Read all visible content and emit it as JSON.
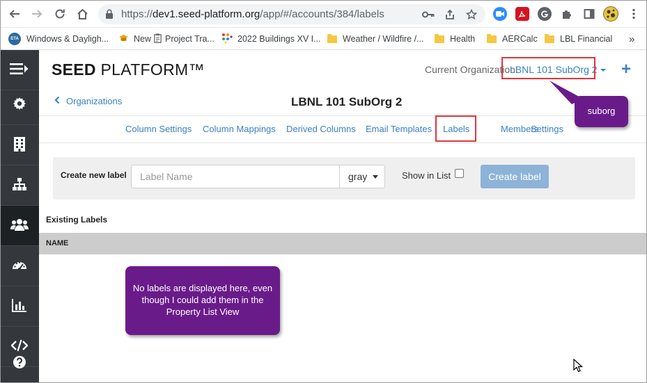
{
  "browser": {
    "url_prefix": "https://",
    "url_host": "dev1.seed-platform.org",
    "url_path": "/app/#/accounts/384/labels",
    "bookmarks": [
      {
        "label": "Windows & Dayligh...",
        "icon": "eta-icon"
      },
      {
        "label": "New",
        "icon": "hat-icon"
      },
      {
        "label": "Project Tra...",
        "icon": "clipboard-icon"
      },
      {
        "label": "2022 Buildings XV I...",
        "icon": "dots-icon"
      },
      {
        "label": "Weather / Wildfire /...",
        "icon": "folder-icon"
      },
      {
        "label": "Health",
        "icon": "folder-icon"
      },
      {
        "label": "AERCalc",
        "icon": "folder-icon"
      },
      {
        "label": "LBL Financial",
        "icon": "folder-icon"
      }
    ],
    "bookmark_eta_text": "ETA",
    "more_bookmarks": "»"
  },
  "app": {
    "logo_bold": "SEED",
    "logo_rest": " PLATFORM™",
    "org_label": "Current Organization:",
    "org_name": "LBNL 101 SubOrg 2",
    "plus": "+"
  },
  "page": {
    "back_link": "Organizations",
    "title": "LBNL 101 SubOrg 2"
  },
  "tabs": [
    "Column Settings",
    "Column Mappings",
    "Derived Columns",
    "Email Templates",
    "Labels",
    "Members",
    "Settings"
  ],
  "create": {
    "label": "Create new label",
    "placeholder": "Label Name",
    "color_value": "gray",
    "show_in_list": "Show in List",
    "button": "Create label"
  },
  "existing": {
    "heading": "Existing Labels",
    "column_name": "NAME"
  },
  "annotations": {
    "suborg": "suborg",
    "note": "No labels are displayed here, even though I could add them in the Property List View"
  },
  "colors": {
    "accent": "#3a82c4",
    "callout": "#6a1b8a",
    "highlight": "#e2343a",
    "sidebar": "#34383c"
  }
}
